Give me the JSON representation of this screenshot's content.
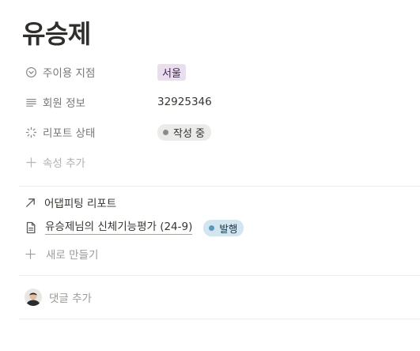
{
  "page": {
    "title": "유승제"
  },
  "properties": [
    {
      "label": "주이용 지점",
      "icon": "chevron-circle-icon",
      "value": "서울",
      "value_type": "select-tag",
      "tag_color": "#e8deee"
    },
    {
      "label": "회원 정보",
      "icon": "text-lines-icon",
      "value": "32925346",
      "value_type": "text"
    },
    {
      "label": "리포트 상태",
      "icon": "status-spinner-icon",
      "value": "작성 중",
      "value_type": "status",
      "status_color": "#8e8b86"
    }
  ],
  "add_property": {
    "label": "속성 추가",
    "icon": "plus-icon"
  },
  "relation": {
    "header": "어댑피팅 리포트",
    "header_icon": "arrow-up-right-icon",
    "items": [
      {
        "title": "유승제님의 신체기능평가 (24-9)",
        "icon": "page-icon",
        "status": "발행",
        "status_color": "#5b97bd"
      }
    ],
    "new_label": "새로 만들기",
    "new_icon": "plus-icon"
  },
  "comments": {
    "placeholder": "댓글 추가",
    "avatar_icon": "avatar"
  },
  "colors": {
    "text": "#37352f",
    "muted": "#787774",
    "placeholder": "#b3b2af",
    "divider": "#ededec"
  }
}
